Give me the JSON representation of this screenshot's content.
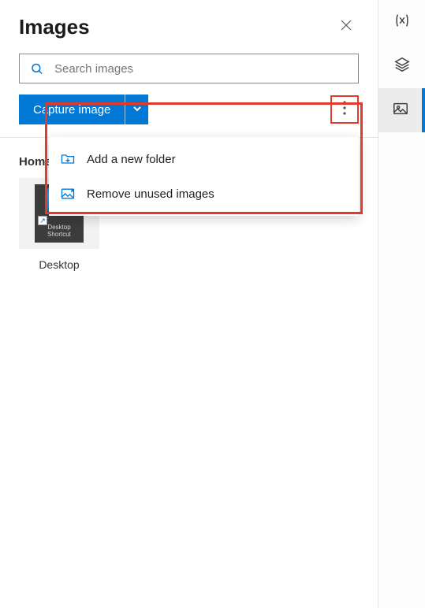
{
  "header": {
    "title": "Images"
  },
  "search": {
    "placeholder": "Search images"
  },
  "actions": {
    "capture_label": "Capture image"
  },
  "breadcrumb": {
    "label": "Home"
  },
  "thumbnails": [
    {
      "label": "Desktop",
      "mini_line1": "Desktop",
      "mini_line2": "Shortcut"
    }
  ],
  "menu": {
    "add_folder": "Add a new folder",
    "remove_unused": "Remove unused images"
  },
  "rail": {
    "items": [
      {
        "name": "variables"
      },
      {
        "name": "layers"
      },
      {
        "name": "images"
      }
    ]
  },
  "colors": {
    "primary": "#0078d4",
    "highlight": "#e23b2e"
  }
}
